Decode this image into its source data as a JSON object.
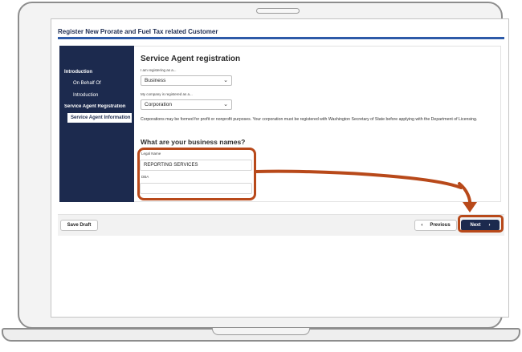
{
  "page": {
    "title": "Register New Prorate and Fuel Tax related Customer"
  },
  "sidebar": {
    "items": [
      {
        "label": "Introduction"
      },
      {
        "label": "On Behalf Of"
      },
      {
        "label": "Introduction"
      },
      {
        "label": "Service Agent Registration"
      },
      {
        "label": "Service Agent Information"
      }
    ]
  },
  "form": {
    "heading": "Service Agent registration",
    "registering_as_label": "I am registering as a...",
    "registering_as_value": "Business",
    "company_registered_label": "My company is registered as a...",
    "company_registered_value": "Corporation",
    "corporation_note": "Corporations may be formed for profit or nonprofit purposes. Your corporation must be registered with Washington Secretary of State before applying with the Department of Licensing.",
    "names_heading": "What are your business names?",
    "legal_name_label": "Legal Name",
    "legal_name_value": "REPORTING SERVICES",
    "dba_label": "DBA",
    "dba_value": ""
  },
  "footer": {
    "save_draft_label": "Save Draft",
    "previous_label": "Previous",
    "next_label": "Next"
  },
  "icons": {
    "previous": "chevron-left-icon",
    "next": "chevron-right-icon",
    "select": "chevron-down-icon"
  },
  "colors": {
    "navy": "#1c2a4e",
    "accent_blue": "#2d5aa8",
    "callout_orange": "#b8491a"
  }
}
